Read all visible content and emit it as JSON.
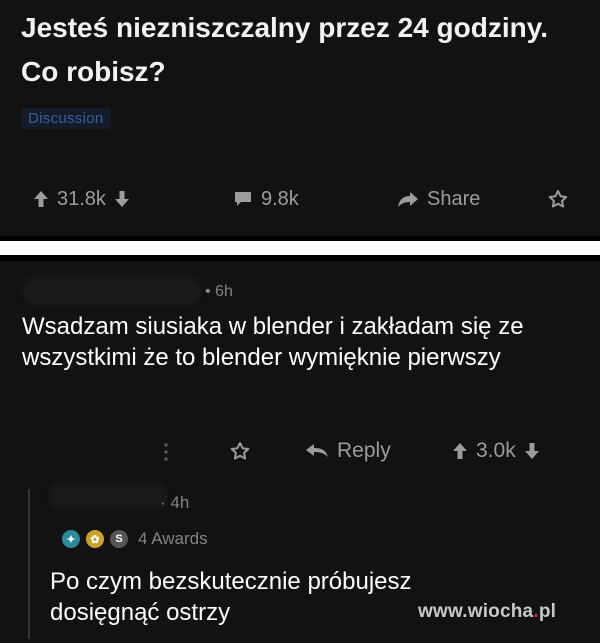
{
  "post": {
    "title": "Jesteś niezniszczalny przez 24 godziny. Co robisz?",
    "flair": "Discussion",
    "upvotes": "31.8k",
    "comments": "9.8k",
    "share_label": "Share"
  },
  "comments": [
    {
      "time": "6h",
      "text": "Wsadzam siusiaka w blender i zakładam się ze wszystkimi że to blender wymięknie pierwszy",
      "reply_label": "Reply",
      "score": "3.0k"
    },
    {
      "time": "4h",
      "awards_label": "4 Awards",
      "text": "Po czym bezskutecznie próbujesz dosięgnąć ostrzy"
    }
  ],
  "watermark": {
    "site": "www.wiocha",
    "dot": ".",
    "tld": "pl"
  },
  "colors": {
    "background": "#121212",
    "separator": "#ffffff",
    "flair_text": "#3d5e9e",
    "action_text": "#9a9c9e"
  }
}
